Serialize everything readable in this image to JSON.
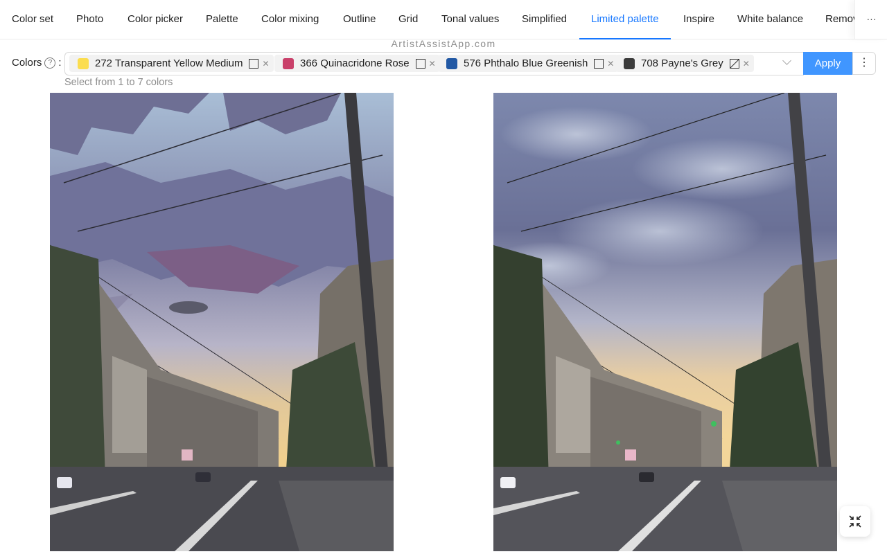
{
  "tabs": [
    {
      "label": "Color set"
    },
    {
      "label": "Photo"
    },
    {
      "label": "Color picker"
    },
    {
      "label": "Palette"
    },
    {
      "label": "Color mixing"
    },
    {
      "label": "Outline"
    },
    {
      "label": "Grid"
    },
    {
      "label": "Tonal values"
    },
    {
      "label": "Simplified"
    },
    {
      "label": "Limited palette",
      "active": true
    },
    {
      "label": "Inspire"
    },
    {
      "label": "White balance"
    },
    {
      "label": "Remov"
    }
  ],
  "more_tabs_label": "···",
  "watermark": "ArtistAssistApp.com",
  "colors": {
    "label": "Colors",
    "help": "?",
    "colon": ":",
    "selected": [
      {
        "label": "272 Transparent Yellow Medium",
        "color": "#fbdd4f",
        "opacity": "transparent"
      },
      {
        "label": "366 Quinacridone Rose",
        "color": "#c9406a",
        "opacity": "transparent"
      },
      {
        "label": "576 Phthalo Blue Greenish",
        "color": "#2158a4",
        "opacity": "transparent"
      },
      {
        "label": "708 Payne's Grey",
        "color": "#3b3b3b",
        "opacity": "semi-transparent"
      }
    ],
    "apply_label": "Apply",
    "more_label": "⋮",
    "hint": "Select from 1 to 7 colors"
  },
  "accent_color": "#1677ff"
}
